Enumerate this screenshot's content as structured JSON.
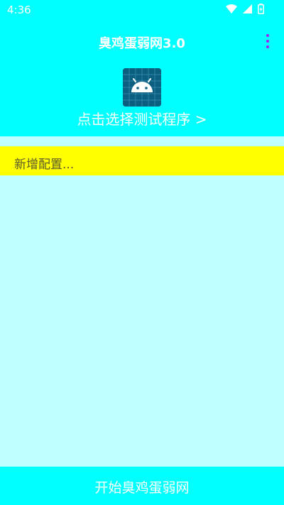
{
  "status_bar": {
    "time": "4:36",
    "icons": [
      "wifi-icon",
      "cell-signal-icon",
      "battery-icon"
    ]
  },
  "app_bar": {
    "title": "臭鸡蛋弱网3.0",
    "overflow_icon": "more-vert-icon"
  },
  "app_selector": {
    "icon": "android-icon",
    "label": "点击选择测试程序 >"
  },
  "config": {
    "add_label": "新增配置..."
  },
  "bottom": {
    "start_label": "开始臭鸡蛋弱网"
  },
  "colors": {
    "header_bg": "#00ffff",
    "content_bg": "#bfffff",
    "config_bg": "#ffff00",
    "accent": "#a020f0"
  }
}
